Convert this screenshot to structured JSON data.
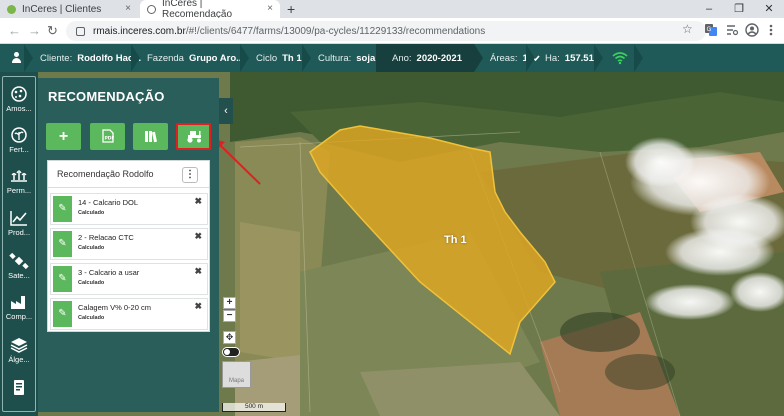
{
  "browser": {
    "tabs": [
      {
        "title": "InCeres | Clientes",
        "close": "×"
      },
      {
        "title": "InCeres | Recomendação",
        "close": "×"
      }
    ],
    "new_tab": "+",
    "url_domain": "rmais.inceres.com.br",
    "url_path": "/#!/clients/6477/farms/13009/pa-cycles/11229133/recommendations",
    "window_controls": {
      "minimize": "–",
      "maximize": "❐",
      "close": "✕"
    },
    "nav": {
      "back": "←",
      "forward": "→",
      "reload": "↻"
    },
    "star": "☆",
    "toolbar_icons": [
      "translate-icon",
      "tab-search-icon",
      "account-icon",
      "menu-icon"
    ]
  },
  "header": {
    "client_label": "Cliente:",
    "client_value": "Rodolfo Hac...",
    "farm_label": "Fazenda",
    "farm_value": "Grupo Aro...",
    "cycle_label": "Ciclo",
    "cycle_value": "Th 1",
    "crop_label": "Cultura:",
    "crop_value": "soja",
    "year_label": "Ano:",
    "year_value": "2020-2021",
    "areas_label": "Áreas:",
    "areas_value": "1",
    "ha_label": "Ha:",
    "ha_value": "157.51",
    "header_bg": "#1f5a58"
  },
  "sidebar": {
    "items": [
      {
        "label": "Amos...",
        "icon": "sampling-icon"
      },
      {
        "label": "Fert...",
        "icon": "fertility-icon"
      },
      {
        "label": "Perm...",
        "icon": "permanent-crop-icon"
      },
      {
        "label": "Prod...",
        "icon": "productivity-chart-icon"
      },
      {
        "label": "Sate...",
        "icon": "satellite-icon"
      },
      {
        "label": "Comp...",
        "icon": "factory-icon"
      },
      {
        "label": "Álge...",
        "icon": "layers-icon"
      },
      {
        "label": "",
        "icon": "document-icon"
      }
    ]
  },
  "panel": {
    "title": "RECOMENDAÇÃO",
    "collapse": "‹",
    "actions": [
      {
        "name": "add",
        "glyph": "+"
      },
      {
        "name": "pdf",
        "glyph": "⎙"
      },
      {
        "name": "book",
        "glyph": "▥"
      },
      {
        "name": "tractor",
        "glyph": "🚜"
      }
    ],
    "card_title": "Recomendação Rodolfo",
    "kebab": "⋮",
    "recommendations": [
      {
        "name": "14 - Calcario DOL",
        "status": "Calculado"
      },
      {
        "name": "2 - Relacao CTC",
        "status": "Calculado"
      },
      {
        "name": "3 - Calcario a usar",
        "status": "Calculado"
      },
      {
        "name": "Calagem V% 0-20 cm",
        "status": "Calculado"
      }
    ],
    "remove_glyph": "✖",
    "item_icon": "✎",
    "accent": "#5cb85c",
    "panel_bg": "#2a5e5b"
  },
  "map": {
    "field_label": "Th 1",
    "field_color": "#e0a722",
    "zoom_in": "+",
    "zoom_out": "−",
    "fullscreen": "✥",
    "basemap_label": "Mapa",
    "scale": "500 m"
  }
}
